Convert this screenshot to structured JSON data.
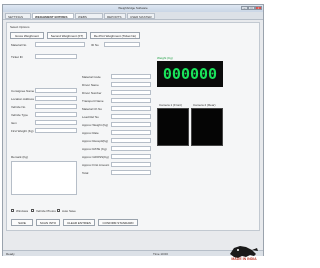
{
  "window": {
    "title": "Weighbridge Software"
  },
  "tabs": [
    "SETTINGS",
    "WEIGHMENT ENTRIES",
    "WEBS MASTER",
    "REPORTS",
    "USER MASTER"
  ],
  "select_options": {
    "label": "Select Options",
    "buttons": [
      "Gross Weighment",
      "Second Weighment (FT)",
      "Re-Print Weighment (Ticket No)"
    ]
  },
  "form": {
    "left_labels": [
      "Material No",
      "Ticket ID",
      "Consignee Name",
      "Location Address",
      "Vehicle No",
      "Vehicle Type",
      "Item",
      "First Weight (Kg)"
    ],
    "ticket_no_label": "ID No",
    "middle_labels": [
      "Material Code",
      "Driver Name",
      "Driver Number",
      "Transport Name",
      "Material Ch No",
      "Load Ref No",
      "Approx Weight (Kg)",
      "Approx Rate",
      "Approx Recepit(Kg)",
      "Approx RATE (Kg)",
      "Approx GROSS(Kg)",
      "Approx First Amount",
      "Total"
    ],
    "remark_label": "Remark (Kg)"
  },
  "weight": {
    "label": "Weight (Kg)",
    "value": "000000"
  },
  "cameras": {
    "cam1_label": "Camera 1 (Front)",
    "cam2_label": "Camera 2 (Rear)"
  },
  "checkboxes": [
    "Windows",
    "Vehicle Photos",
    "Auto Save"
  ],
  "actions": [
    "SAVE",
    "SCAN INTO",
    "CLEAR ENTRIES",
    "CONFIRM STANDARD"
  ],
  "status": {
    "left": "Ready",
    "right": "Time 10:00"
  },
  "watermark": "MADE IN INDIA",
  "colors": {
    "display_text": "#19e35a",
    "display_bg": "#0b0b0b"
  }
}
